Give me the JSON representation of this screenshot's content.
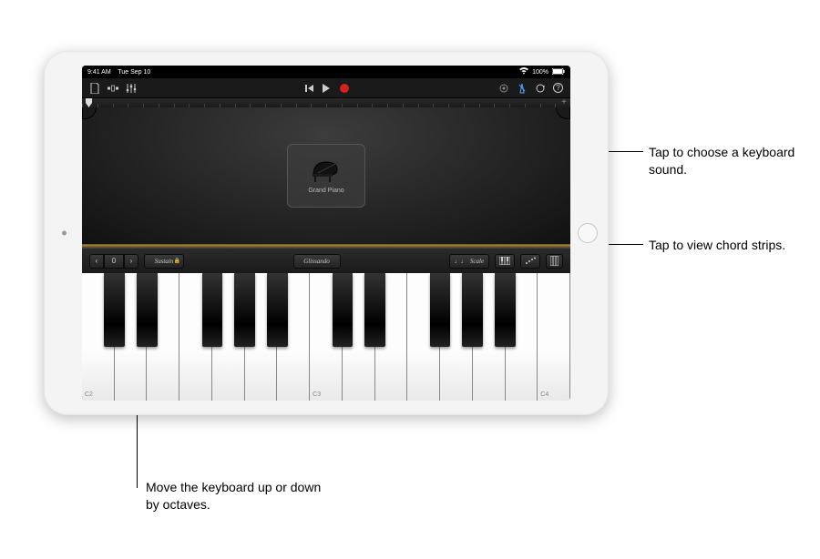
{
  "status_bar": {
    "time": "9:41 AM",
    "date": "Tue Sep 10",
    "signal": "•••",
    "battery": "100%"
  },
  "toolbar": {
    "new_project_icon": "document",
    "browser_icon": "browser",
    "mixer_icon": "sliders",
    "transport": {
      "rewind": "go-to-beginning",
      "play": "play",
      "record": "record"
    },
    "metronome_icon": "metronome",
    "loop_icon": "loop",
    "help_icon": "?"
  },
  "ruler": {
    "add_label": "+"
  },
  "instrument": {
    "sound_name": "Grand Piano"
  },
  "controls": {
    "octave_down": "‹",
    "octave_value": "0",
    "octave_up": "›",
    "sustain_label": "Sustain",
    "glissando_label": "Glissando",
    "scale_label": "Scale",
    "scale_note": "♩♩",
    "keyboard_layout_icon": "keyboard-size",
    "arpeggiator_icon": "arpeggiator",
    "chord_strips_icon": "chord-strips"
  },
  "key_labels": {
    "c2": "C2",
    "c3": "C3",
    "c4": "C4"
  },
  "callouts": {
    "sound": "Tap to choose a keyboard sound.",
    "chords": "Tap to view chord strips.",
    "octave": "Move the keyboard up or down by octaves."
  }
}
